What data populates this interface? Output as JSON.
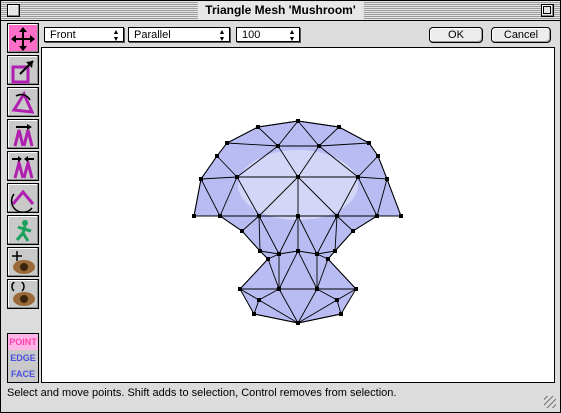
{
  "window": {
    "title": "Triangle Mesh 'Mushroom'"
  },
  "toolbar": {
    "view_popup": "Front",
    "projection_popup": "Parallel",
    "zoom_popup": "100",
    "ok_label": "OK",
    "cancel_label": "Cancel"
  },
  "tools": [
    {
      "name": "move-points-icon",
      "active": true
    },
    {
      "name": "scale-icon",
      "active": false
    },
    {
      "name": "rotate-icon",
      "active": false
    },
    {
      "name": "extrude-icon",
      "active": false
    },
    {
      "name": "pinch-icon",
      "active": false
    },
    {
      "name": "twist-icon",
      "active": false
    },
    {
      "name": "figure-icon",
      "active": false
    },
    {
      "name": "move-view-eye-icon",
      "active": false
    },
    {
      "name": "rotate-view-eye-icon",
      "active": false
    }
  ],
  "selection_modes": {
    "point": "POINT",
    "edge": "EDGE",
    "face": "FACE",
    "active": "point"
  },
  "status": {
    "text": "Select and move points.  Shift adds to selection, Control removes from selection."
  },
  "colors": {
    "mesh_fill": "#b8bcf2",
    "mesh_fill_light": "#dfe1fb",
    "active_tool": "#ff6ec7"
  }
}
